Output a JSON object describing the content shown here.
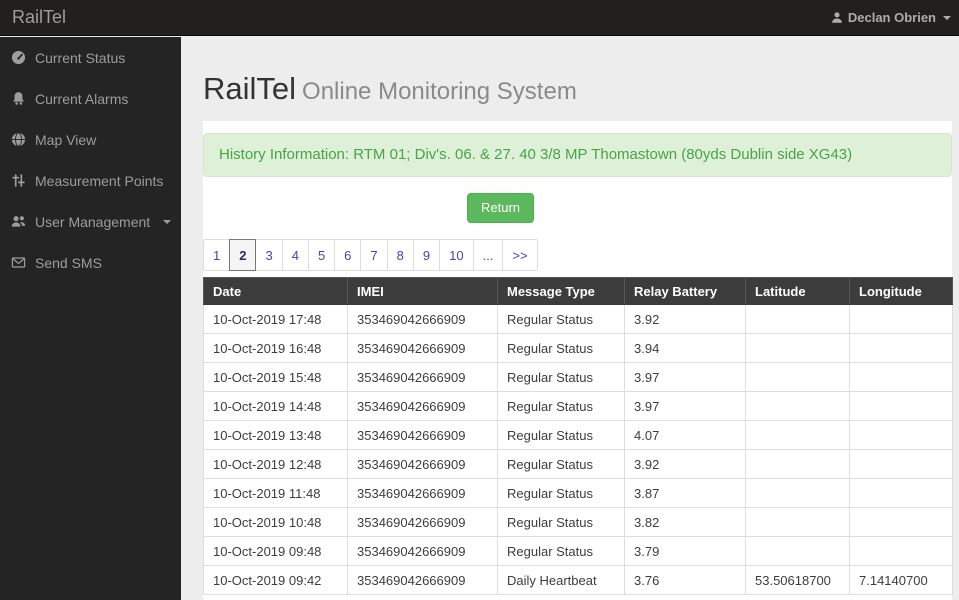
{
  "topbar": {
    "brand": "RailTel",
    "user": "Declan Obrien",
    "user_icon": "user-icon",
    "caret_icon": "chevron-down-icon"
  },
  "sidebar": {
    "items": [
      {
        "icon": "dashboard-icon",
        "label": "Current Status",
        "has_caret": false
      },
      {
        "icon": "alarm-icon",
        "label": "Current Alarms",
        "has_caret": false
      },
      {
        "icon": "globe-icon",
        "label": "Map View",
        "has_caret": false
      },
      {
        "icon": "measurement-icon",
        "label": "Measurement Points",
        "has_caret": false
      },
      {
        "icon": "users-icon",
        "label": "User Management",
        "has_caret": true
      },
      {
        "icon": "envelope-icon",
        "label": "Send SMS",
        "has_caret": false
      }
    ]
  },
  "main": {
    "title": "RailTel",
    "subtitle": "Online Monitoring System",
    "history_banner": "History Information: RTM 01; Div's. 06. & 27. 40 3/8 MP Thomastown (80yds Dublin side XG43)",
    "return_label": "Return",
    "pagination": {
      "pages": [
        "1",
        "2",
        "3",
        "4",
        "5",
        "6",
        "7",
        "8",
        "9",
        "10",
        "...",
        ">>"
      ],
      "active": "2"
    },
    "table": {
      "columns": [
        "Date",
        "IMEI",
        "Message Type",
        "Relay Battery",
        "Latitude",
        "Longitude"
      ],
      "rows": [
        [
          "10-Oct-2019 17:48",
          "353469042666909",
          "Regular Status",
          "3.92",
          "",
          ""
        ],
        [
          "10-Oct-2019 16:48",
          "353469042666909",
          "Regular Status",
          "3.94",
          "",
          ""
        ],
        [
          "10-Oct-2019 15:48",
          "353469042666909",
          "Regular Status",
          "3.97",
          "",
          ""
        ],
        [
          "10-Oct-2019 14:48",
          "353469042666909",
          "Regular Status",
          "3.97",
          "",
          ""
        ],
        [
          "10-Oct-2019 13:48",
          "353469042666909",
          "Regular Status",
          "4.07",
          "",
          ""
        ],
        [
          "10-Oct-2019 12:48",
          "353469042666909",
          "Regular Status",
          "3.92",
          "",
          ""
        ],
        [
          "10-Oct-2019 11:48",
          "353469042666909",
          "Regular Status",
          "3.87",
          "",
          ""
        ],
        [
          "10-Oct-2019 10:48",
          "353469042666909",
          "Regular Status",
          "3.82",
          "",
          ""
        ],
        [
          "10-Oct-2019 09:48",
          "353469042666909",
          "Regular Status",
          "3.79",
          "",
          ""
        ],
        [
          "10-Oct-2019 09:42",
          "353469042666909",
          "Daily Heartbeat",
          "3.76",
          "53.50618700",
          "7.14140700"
        ]
      ]
    }
  },
  "colors": {
    "topbar_bg": "#221f1f",
    "sidebar_bg": "#242424",
    "page_bg": "#ededed",
    "banner_bg": "#dff0d8",
    "banner_text": "#47a447",
    "accent_green": "#5cb85c",
    "table_header_bg": "#3c3c3c",
    "pagination_link": "#4343b5"
  }
}
